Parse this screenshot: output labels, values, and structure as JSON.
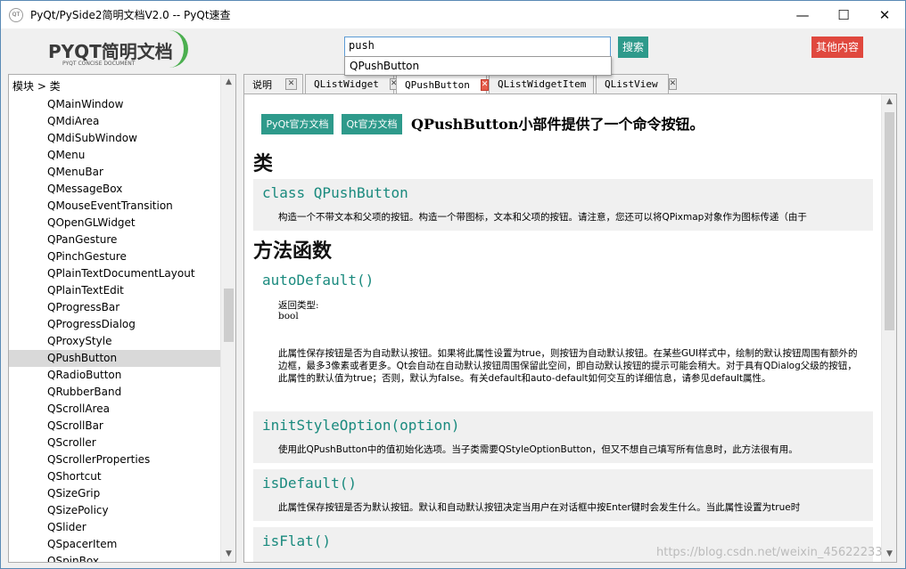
{
  "window": {
    "title": "PyQt/PySide2简明文档V2.0  -- PyQt速查",
    "app_icon_text": "QT",
    "minimize": "—",
    "maximize": "☐",
    "close": "✕"
  },
  "header": {
    "logo_main": "PYQT简明文档",
    "logo_sub": "PYQT CONCISE DOCUMENT",
    "search_value": "push",
    "search_button": "搜索",
    "other_button": "其他内容",
    "suggestion": "QPushButton"
  },
  "tree": {
    "header": "模块 > 类",
    "items": [
      "QMainWindow",
      "QMdiArea",
      "QMdiSubWindow",
      "QMenu",
      "QMenuBar",
      "QMessageBox",
      "QMouseEventTransition",
      "QOpenGLWidget",
      "QPanGesture",
      "QPinchGesture",
      "QPlainTextDocumentLayout",
      "QPlainTextEdit",
      "QProgressBar",
      "QProgressDialog",
      "QProxyStyle",
      "QPushButton",
      "QRadioButton",
      "QRubberBand",
      "QScrollArea",
      "QScrollBar",
      "QScroller",
      "QScrollerProperties",
      "QShortcut",
      "QSizeGrip",
      "QSizePolicy",
      "QSlider",
      "QSpacerItem",
      "QSpinBox"
    ],
    "selected": "QPushButton"
  },
  "tabs": [
    {
      "label": "说明",
      "active": false
    },
    {
      "label": "QListWidget",
      "active": false
    },
    {
      "label": "QPushButton",
      "active": true
    },
    {
      "label": "QListWidgetItem",
      "active": false
    },
    {
      "label": "QListView",
      "active": false
    }
  ],
  "content": {
    "btn_pyqt_doc": "PyQt官方文档",
    "btn_qt_doc": "Qt官方文档",
    "intro": "QPushButton小部件提供了一个命令按钮。",
    "section_class": "类",
    "class_title": "class QPushButton",
    "class_desc": "构造一个不带文本和父项的按钮。构造一个带图标，文本和父项的按钮。请注意，您还可以将QPixmap对象作为图标传递（由于",
    "section_methods": "方法函数",
    "methods": [
      {
        "name": "autoDefault()",
        "return_label": "返回类型:",
        "return_type": "bool",
        "desc": "此属性保存按钮是否为自动默认按钮。如果将此属性设置为true，则按钮为自动默认按钮。在某些GUI样式中，绘制的默认按钮周围有额外的边框，最多3像素或者更多。Qt会自动在自动默认按钮周围保留此空间，即自动默认按钮的提示可能会稍大。对于具有QDialog父级的按钮，此属性的默认值为true；否则，默认为false。有关default和auto-default如何交互的详细信息，请参见default属性。"
      },
      {
        "name": "initStyleOption(option)",
        "desc": "使用此QPushButton中的值初始化选项。当子类需要QStyleOptionButton，但又不想自己填写所有信息时，此方法很有用。"
      },
      {
        "name": "isDefault()",
        "desc": "此属性保存按钮是否为默认按钮。默认和自动默认按钮决定当用户在对话框中按Enter键时会发生什么。当此属性设置为true时"
      },
      {
        "name": "isFlat()"
      }
    ]
  },
  "watermark": "https://blog.csdn.net/weixin_45622233"
}
